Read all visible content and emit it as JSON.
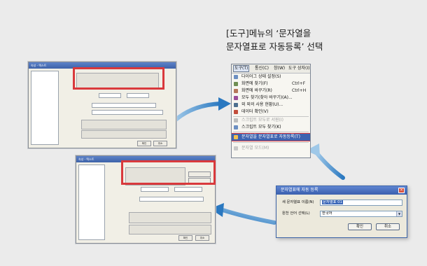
{
  "caption": {
    "line1": "[도구]메뉴의 ‘문자열을",
    "line2": "문자열표로 자동등록’ 선택"
  },
  "menu": {
    "bar_items": [
      "도구(T)",
      "통신(C)",
      "창(W)",
      "도구 상자(I)"
    ],
    "items": [
      {
        "label": "다이어그 상태 설정(S)",
        "shortcut": "",
        "state": "normal",
        "icon_color": "#6c8fc2"
      },
      {
        "label": "화면에 찾기(F)",
        "shortcut": "Ctrl+F",
        "state": "normal",
        "icon_color": "#6f8e52"
      },
      {
        "label": "화면에 바꾸기(R)",
        "shortcut": "Ctrl+H",
        "state": "normal",
        "icon_color": "#b5775a"
      },
      {
        "label": "모두 찾기(찾아 바꾸기)(A)...",
        "shortcut": "",
        "state": "normal",
        "icon_color": "#9b4d9a"
      },
      {
        "label": "외 외의 사용 현황(U)...",
        "shortcut": "",
        "state": "normal",
        "icon_color": "#4c6f8f"
      },
      {
        "label": "데이터 확인(V)",
        "shortcut": "",
        "state": "normal",
        "icon_color": "#c24d3b"
      },
      {
        "label": "스크립트 모두로 서원(I)",
        "shortcut": "",
        "state": "disabled",
        "icon_color": "#bdbdbd"
      },
      {
        "label": "스크립트 모두 찾기(K)",
        "shortcut": "",
        "state": "normal",
        "icon_color": "#6c8fc2"
      },
      {
        "label": "문자열을 문자열표로 자동등록(T)",
        "shortcut": "",
        "state": "selected",
        "icon_color": "#f1c04f"
      },
      {
        "label": "문자열 모드(M)",
        "shortcut": "",
        "state": "disabled",
        "icon_color": "#c8c8c8"
      }
    ]
  },
  "dialog": {
    "title": "문자열표에 자동 등록",
    "label_name": "새 문자열표 이름(N)",
    "name_value": "문자열표 01",
    "label_lang": "원천 언어 선택(L)",
    "lang_value": "한국어",
    "ok_label": "확인",
    "cancel_label": "취소"
  },
  "dialog_small_top": {
    "title": "속성 - 텍스트",
    "ok_label": "확인",
    "cancel_label": "취소"
  },
  "dialog_small_bottom": {
    "title": "속성 - 텍스트",
    "ok_label": "확인",
    "cancel_label": "취소"
  },
  "colors": {
    "highlight_red": "#d9393c",
    "arrow_blue": "#2f7fc3",
    "selection_blue": "#3e63b0"
  }
}
